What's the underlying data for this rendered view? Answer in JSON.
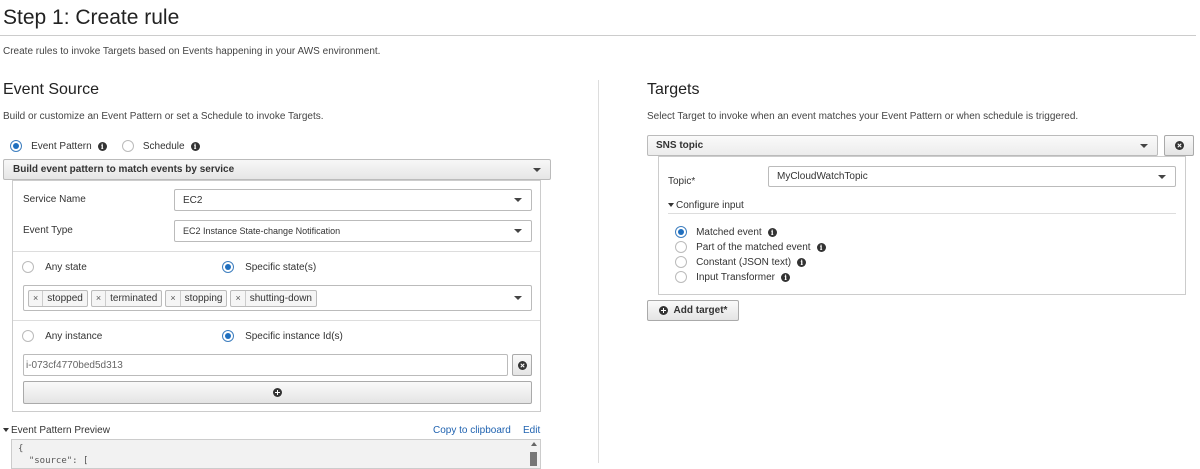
{
  "header": {
    "title": "Step 1: Create rule",
    "subtitle": "Create rules to invoke Targets based on Events happening in your AWS environment."
  },
  "event_source": {
    "title": "Event Source",
    "description": "Build or customize an Event Pattern or set a Schedule to invoke Targets.",
    "mode_options": [
      {
        "label": "Event Pattern",
        "selected": true
      },
      {
        "label": "Schedule",
        "selected": false
      }
    ],
    "builder_label": "Build event pattern to match events by service",
    "service_name": {
      "label": "Service Name",
      "value": "EC2"
    },
    "event_type": {
      "label": "Event Type",
      "value": "EC2 Instance State-change Notification"
    },
    "state_options": [
      {
        "label": "Any state",
        "selected": false
      },
      {
        "label": "Specific state(s)",
        "selected": true
      }
    ],
    "states": [
      "stopped",
      "terminated",
      "stopping",
      "shutting-down"
    ],
    "tag_remove_glyph": "×",
    "instance_options": [
      {
        "label": "Any instance",
        "selected": false
      },
      {
        "label": "Specific instance Id(s)",
        "selected": true
      }
    ],
    "instance_id": "i-073cf4770bed5d313",
    "preview": {
      "label": "Event Pattern Preview",
      "copy_label": "Copy to clipboard",
      "edit_label": "Edit",
      "code_lines": [
        "{",
        "  \"source\": ["
      ]
    }
  },
  "targets": {
    "title": "Targets",
    "description": "Select Target to invoke when an event matches your Event Pattern or when schedule is triggered.",
    "target_type": "SNS topic",
    "topic": {
      "label": "Topic*",
      "value": "MyCloudWatchTopic"
    },
    "configure_input_label": "Configure input",
    "input_options": [
      {
        "label": "Matched event",
        "selected": true
      },
      {
        "label": "Part of the matched event",
        "selected": false
      },
      {
        "label": "Constant (JSON text)",
        "selected": false
      },
      {
        "label": "Input Transformer",
        "selected": false
      }
    ],
    "add_target_label": "Add target*"
  },
  "colors": {
    "radio_selected": "#1f6fbf",
    "link": "#1f62b0",
    "panel_border": "#cccccc"
  }
}
